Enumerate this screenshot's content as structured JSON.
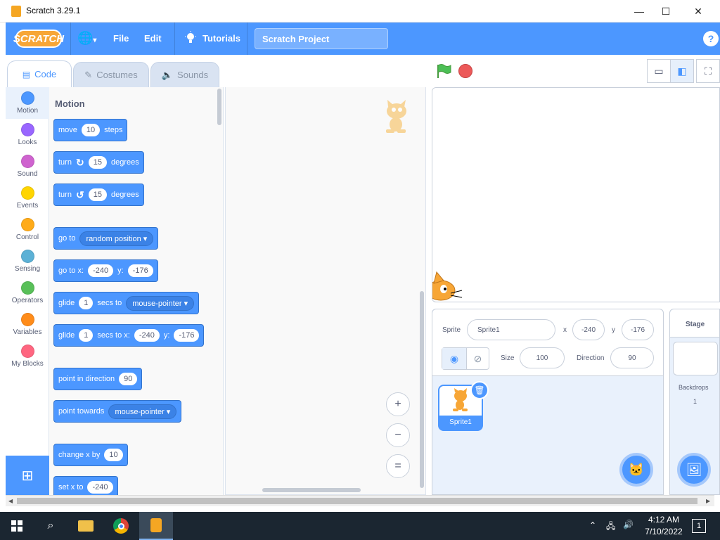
{
  "window": {
    "title": "Scratch 3.29.1",
    "minimize": "—",
    "maximize": "☐",
    "close": "✕"
  },
  "menu": {
    "logo": "SCRATCH",
    "globe": "🌐",
    "file": "File",
    "edit": "Edit",
    "tutorials": "Tutorials",
    "project_title": "Scratch Project",
    "help": "?"
  },
  "tabs": {
    "code": "Code",
    "costumes": "Costumes",
    "sounds": "Sounds"
  },
  "categories": [
    {
      "label": "Motion",
      "color": "#4c97ff"
    },
    {
      "label": "Looks",
      "color": "#9966ff"
    },
    {
      "label": "Sound",
      "color": "#cf63cf"
    },
    {
      "label": "Events",
      "color": "#ffd500"
    },
    {
      "label": "Control",
      "color": "#ffab19"
    },
    {
      "label": "Sensing",
      "color": "#5cb1d6"
    },
    {
      "label": "Operators",
      "color": "#59c059"
    },
    {
      "label": "Variables",
      "color": "#ff8c1a"
    },
    {
      "label": "My Blocks",
      "color": "#ff6680"
    }
  ],
  "palette": {
    "title": "Motion",
    "move": {
      "a": "move",
      "v": "10",
      "b": "steps"
    },
    "turn_right": {
      "a": "turn",
      "icon": "↻",
      "v": "15",
      "b": "degrees"
    },
    "turn_left": {
      "a": "turn",
      "icon": "↺",
      "v": "15",
      "b": "degrees"
    },
    "goto": {
      "a": "go to",
      "dd": "random position ▾"
    },
    "gotoxy": {
      "a": "go to x:",
      "x": "-240",
      "b": "y:",
      "y": "-176"
    },
    "glide": {
      "a": "glide",
      "v": "1",
      "b": "secs to",
      "dd": "mouse-pointer ▾"
    },
    "glidexy": {
      "a": "glide",
      "v": "1",
      "b": "secs to x:",
      "x": "-240",
      "c": "y:",
      "y": "-176"
    },
    "point_dir": {
      "a": "point in direction",
      "v": "90"
    },
    "point_towards": {
      "a": "point towards",
      "dd": "mouse-pointer ▾"
    },
    "change_x": {
      "a": "change x by",
      "v": "10"
    },
    "set_x": {
      "a": "set x to",
      "v": "-240"
    }
  },
  "zoom": {
    "in": "+",
    "out": "−",
    "reset": "="
  },
  "stage_header": {
    "flag": "⚑"
  },
  "sprite_info": {
    "sprite_label": "Sprite",
    "sprite_name": "Sprite1",
    "x_label": "x",
    "x": "-240",
    "y_label": "y",
    "y": "-176",
    "show_label": "Show",
    "size_label": "Size",
    "size": "100",
    "direction_label": "Direction",
    "direction": "90"
  },
  "sprite_tile": {
    "name": "Sprite1"
  },
  "stage_pane": {
    "label": "Stage",
    "backdrops_label": "Backdrops",
    "backdrops_count": "1"
  },
  "taskbar": {
    "time": "4:12 AM",
    "date": "7/10/2022",
    "notifications": "1"
  }
}
